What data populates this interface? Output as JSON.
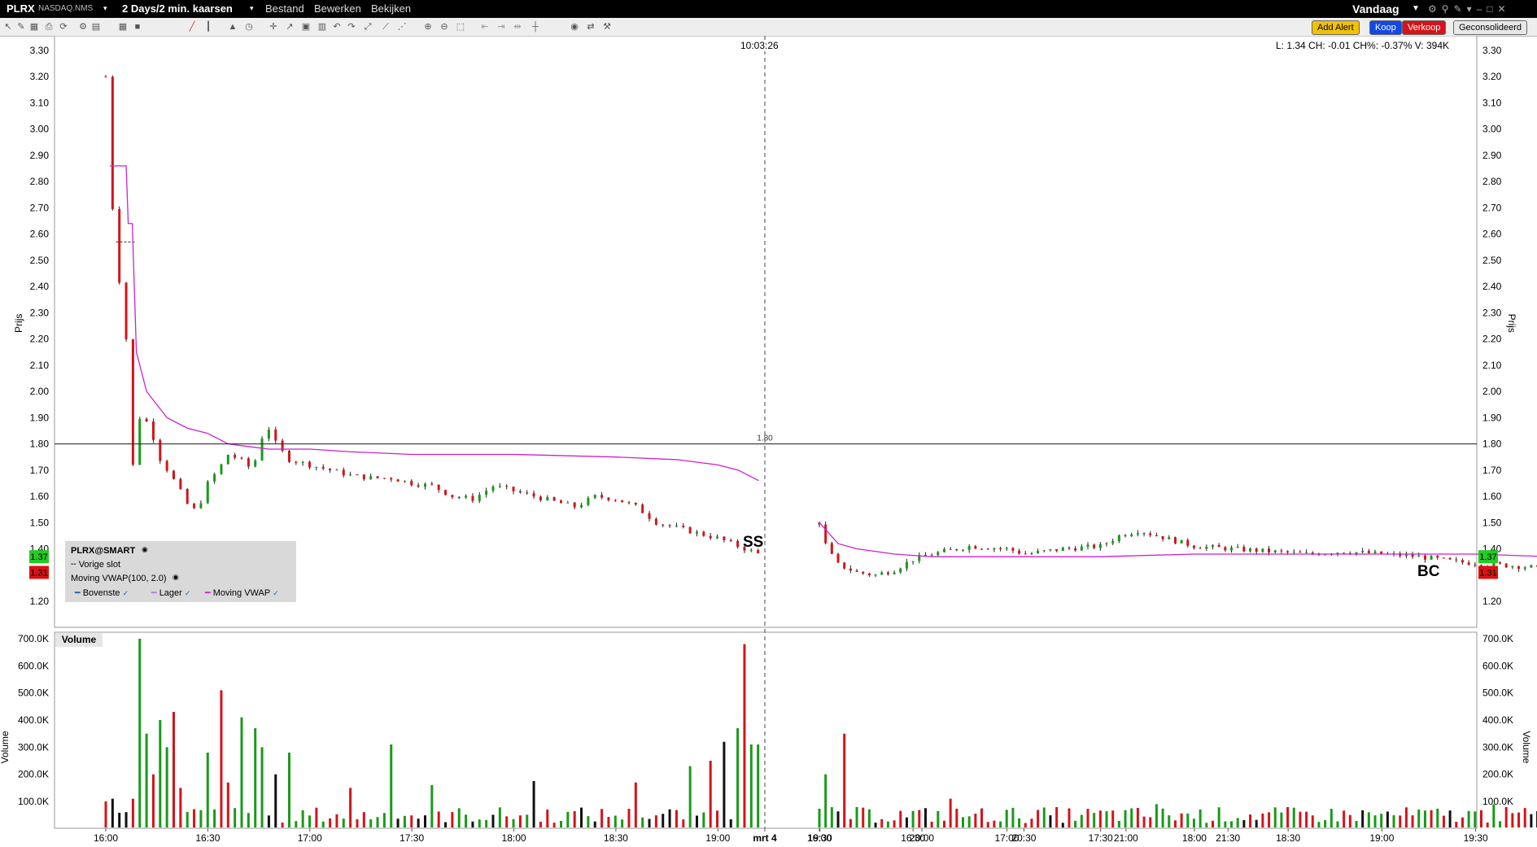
{
  "window": {
    "symbol": "PLRX",
    "exchange": "NASDAQ.NMS",
    "period": "2 Days/2 min. kaarsen",
    "menus": [
      "Bestand",
      "Bewerken",
      "Bekijken"
    ],
    "range_selector": "Vandaag"
  },
  "toolbar": {
    "add_alert": "Add Alert",
    "buy": "Koop",
    "sell": "Verkoop",
    "consolidated": "Geconsolideerd"
  },
  "colors": {
    "up": "#1a9a1a",
    "down": "#d4141a",
    "vwap": "#cc22cc",
    "buy_button": "#1447e8",
    "sell_button": "#d4141a",
    "alert_button": "#f2c200",
    "last_price_green": "#22cc22",
    "last_price_red": "#dd1111"
  },
  "crosshair": {
    "time": "10:03:26",
    "info": "L: 1.34 CH: -0.01 CH%: -0.37% V: 394K",
    "price_line_label": "1.80"
  },
  "markers": {
    "short_sell": "SS",
    "buy_cover": "BC"
  },
  "legend": {
    "symbol": "PLRX@SMART",
    "prev_close": "Vorige slot",
    "study": "Moving VWAP(100, 2.0)",
    "upper": "Bovenste",
    "lower": "Lager",
    "vwap": "Moving VWAP"
  },
  "last_price_labels": [
    "1.37",
    "1.31"
  ],
  "chart_data": [
    {
      "type": "candlestick",
      "ylabel": "Prijs",
      "ylim": [
        1.15,
        3.35
      ],
      "yticks": [
        "3.30",
        "3.20",
        "3.10",
        "3.00",
        "2.90",
        "2.80",
        "2.70",
        "2.60",
        "2.50",
        "2.40",
        "2.30",
        "2.20",
        "2.10",
        "2.00",
        "1.90",
        "1.80",
        "1.70",
        "1.60",
        "1.50",
        "1.40",
        "1.20"
      ],
      "xticks": [
        "16:00",
        "16:30",
        "17:00",
        "17:30",
        "18:00",
        "18:30",
        "19:00",
        "19:30",
        "20:00",
        "20:30",
        "21:00",
        "21:30",
        "mrt 4",
        "16:00",
        "16:30",
        "17:00",
        "17:30",
        "18:00",
        "18:30",
        "19:00",
        "19:30",
        "20:00",
        "20:30",
        "21:00",
        "21:30"
      ],
      "horizontal_line": 1.8,
      "grid": false,
      "price_path_day1": [
        [
          0.0,
          3.2
        ],
        [
          0.02,
          2.9
        ],
        [
          0.04,
          2.6
        ],
        [
          0.1,
          2.2
        ],
        [
          0.13,
          1.7
        ],
        [
          0.17,
          1.92
        ],
        [
          0.22,
          1.86
        ],
        [
          0.26,
          1.75
        ],
        [
          0.32,
          1.68
        ],
        [
          0.38,
          1.6
        ],
        [
          0.42,
          1.54
        ],
        [
          0.46,
          1.57
        ],
        [
          0.5,
          1.65
        ],
        [
          0.55,
          1.7
        ],
        [
          0.6,
          1.76
        ],
        [
          0.66,
          1.74
        ],
        [
          0.72,
          1.7
        ],
        [
          0.76,
          1.82
        ],
        [
          0.8,
          1.86
        ],
        [
          0.84,
          1.79
        ],
        [
          0.9,
          1.74
        ],
        [
          1.0,
          1.72
        ],
        [
          1.1,
          1.7
        ],
        [
          1.2,
          1.68
        ],
        [
          1.3,
          1.67
        ],
        [
          1.4,
          1.67
        ],
        [
          1.5,
          1.65
        ],
        [
          1.6,
          1.64
        ],
        [
          1.7,
          1.6
        ],
        [
          1.8,
          1.59
        ],
        [
          1.9,
          1.64
        ],
        [
          2.0,
          1.62
        ],
        [
          2.1,
          1.6
        ],
        [
          2.2,
          1.58
        ],
        [
          2.3,
          1.56
        ],
        [
          2.4,
          1.6
        ],
        [
          2.5,
          1.59
        ],
        [
          2.6,
          1.56
        ],
        [
          2.7,
          1.5
        ],
        [
          2.8,
          1.48
        ],
        [
          2.9,
          1.46
        ],
        [
          3.0,
          1.44
        ],
        [
          3.1,
          1.41
        ],
        [
          3.2,
          1.38
        ]
      ],
      "price_path_day2": [
        [
          0.0,
          1.5
        ],
        [
          0.04,
          1.4
        ],
        [
          0.1,
          1.34
        ],
        [
          0.2,
          1.31
        ],
        [
          0.3,
          1.3
        ],
        [
          0.4,
          1.32
        ],
        [
          0.5,
          1.36
        ],
        [
          0.6,
          1.38
        ],
        [
          0.8,
          1.41
        ],
        [
          1.0,
          1.4
        ],
        [
          1.1,
          1.38
        ],
        [
          1.3,
          1.4
        ],
        [
          1.5,
          1.41
        ],
        [
          1.6,
          1.45
        ],
        [
          1.7,
          1.47
        ],
        [
          1.8,
          1.45
        ],
        [
          1.9,
          1.43
        ],
        [
          2.0,
          1.41
        ],
        [
          2.2,
          1.4
        ],
        [
          2.4,
          1.39
        ],
        [
          2.6,
          1.38
        ],
        [
          2.8,
          1.39
        ],
        [
          3.0,
          1.38
        ],
        [
          3.2,
          1.37
        ],
        [
          3.4,
          1.35
        ],
        [
          3.6,
          1.34
        ],
        [
          3.8,
          1.33
        ],
        [
          3.95,
          1.29
        ],
        [
          4.0,
          1.31
        ]
      ],
      "moving_vwap_day1": [
        [
          0.02,
          2.86
        ],
        [
          0.1,
          2.86
        ],
        [
          0.11,
          2.64
        ],
        [
          0.13,
          2.64
        ],
        [
          0.15,
          2.15
        ],
        [
          0.2,
          2.0
        ],
        [
          0.3,
          1.9
        ],
        [
          0.4,
          1.86
        ],
        [
          0.5,
          1.84
        ],
        [
          0.6,
          1.8
        ],
        [
          0.7,
          1.79
        ],
        [
          0.8,
          1.78
        ],
        [
          1.0,
          1.78
        ],
        [
          1.2,
          1.77
        ],
        [
          1.5,
          1.76
        ],
        [
          2.0,
          1.76
        ],
        [
          2.5,
          1.75
        ],
        [
          2.8,
          1.74
        ],
        [
          3.0,
          1.72
        ],
        [
          3.1,
          1.7
        ],
        [
          3.2,
          1.66
        ]
      ],
      "moving_vwap_day2": [
        [
          0.0,
          1.5
        ],
        [
          0.1,
          1.42
        ],
        [
          0.2,
          1.4
        ],
        [
          0.4,
          1.38
        ],
        [
          0.6,
          1.37
        ],
        [
          1.0,
          1.37
        ],
        [
          1.5,
          1.37
        ],
        [
          2.0,
          1.38
        ],
        [
          2.5,
          1.38
        ],
        [
          3.0,
          1.38
        ],
        [
          3.5,
          1.38
        ],
        [
          3.9,
          1.37
        ],
        [
          4.0,
          1.36
        ]
      ]
    },
    {
      "type": "bar",
      "title": "Volume",
      "ylabel": "Volume",
      "ylim": [
        0,
        720000
      ],
      "yticks": [
        "700.0K",
        "600.0K",
        "500.0K",
        "400.0K",
        "300.0K",
        "200.0K",
        "100.0K"
      ],
      "volume_spikes_day1": [
        [
          0.0,
          100000
        ],
        [
          0.02,
          90000
        ],
        [
          0.04,
          110000
        ],
        [
          0.14,
          110000
        ],
        [
          0.18,
          700000
        ],
        [
          0.2,
          350000
        ],
        [
          0.24,
          200000
        ],
        [
          0.28,
          400000
        ],
        [
          0.3,
          300000
        ],
        [
          0.34,
          430000
        ],
        [
          0.38,
          150000
        ],
        [
          0.5,
          280000
        ],
        [
          0.56,
          510000
        ],
        [
          0.6,
          170000
        ],
        [
          0.66,
          410000
        ],
        [
          0.72,
          370000
        ],
        [
          0.76,
          300000
        ],
        [
          0.82,
          200000
        ],
        [
          0.9,
          280000
        ],
        [
          1.2,
          150000
        ],
        [
          1.4,
          310000
        ],
        [
          1.6,
          160000
        ],
        [
          2.1,
          175000
        ],
        [
          2.6,
          170000
        ],
        [
          2.88,
          230000
        ],
        [
          2.96,
          250000
        ],
        [
          3.04,
          320000
        ],
        [
          3.1,
          370000
        ],
        [
          3.14,
          680000
        ],
        [
          3.18,
          310000
        ]
      ],
      "volume_spikes_day2": [
        [
          0.04,
          200000
        ],
        [
          0.14,
          350000
        ],
        [
          0.7,
          110000
        ],
        [
          1.8,
          90000
        ],
        [
          2.4,
          60000
        ],
        [
          3.2,
          70000
        ],
        [
          3.6,
          90000
        ],
        [
          3.85,
          130000
        ],
        [
          3.9,
          150000
        ],
        [
          3.94,
          160000
        ],
        [
          3.98,
          450000
        ],
        [
          4.0,
          570000
        ]
      ]
    }
  ]
}
